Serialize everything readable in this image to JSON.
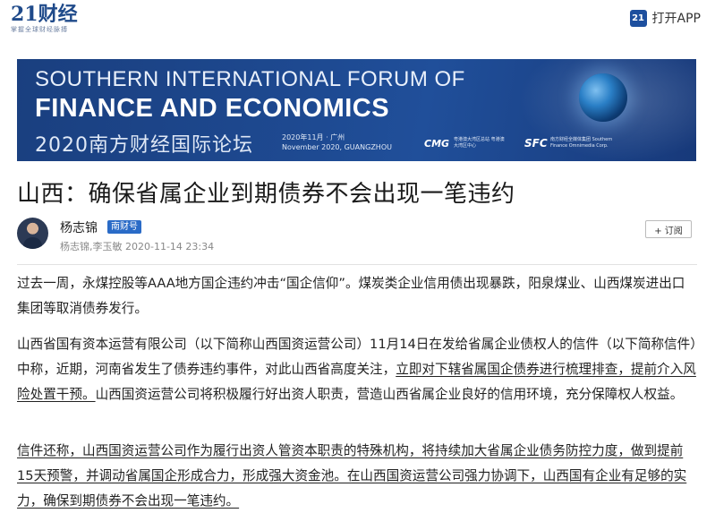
{
  "header": {
    "logo_text": "21财经",
    "logo_tagline": "掌握全球财经脉搏",
    "app_icon_text": "21",
    "app_button_label": "打开APP"
  },
  "banner": {
    "line1": "SOUTHERN INTERNATIONAL FORUM OF",
    "line2": "FINANCE AND ECONOMICS",
    "cn_title": "2020南方财经国际论坛",
    "date_cn": "2020年11月 · 广州",
    "date_en": "November 2020, GUANGZHOU",
    "logo_cmg": "CMG",
    "logo_cmg_sub": "粤港澳大湾区总站 粤港澳大湾区中心",
    "logo_sfc": "SFC",
    "logo_sfc_sub": "南方财经全媒体集团 Southern Finance Omnimedia Corp."
  },
  "article": {
    "title": "山西：确保省属企业到期债券不会出现一笔违约",
    "author": {
      "name": "杨志锦",
      "badge": "南财号",
      "meta": "杨志锦,李玉敏 2020-11-14 23:34",
      "subscribe_label": "+ 订阅"
    },
    "paragraphs": {
      "p1": "过去一周，永煤控股等AAA地方国企违约冲击“国企信仰”。煤炭类企业信用债出现暴跌，阳泉煤业、山西煤炭进出口集团等取消债券发行。",
      "p2_a": "山西省国有资本运营有限公司（以下简称山西国资运营公司）11月14日在发给省属企业债权人的信件（以下简称信件）中称，近期，河南省发生了债券违约事件，对此山西省高度关注，",
      "p2_u": "立即对下辖省属国企债券进行梳理排查，提前介入风险处置干预。",
      "p2_b": "山西国资运营公司将积极履行好出资人职责，营造山西省属企业良好的信用环境，充分保障权人权益。",
      "p3": "信件还称，山西国资运营公司作为履行出资人管资本职责的特殊机构，将持续加大省属企业债务防控力度，做到提前15天预警，并调动省属国企形成合力，形成强大资金池。在山西国资运营公司强力协调下，山西国有企业有足够的实力，确保到期债券不会出现一笔违约。"
    }
  },
  "colors": {
    "brand_blue": "#1f4a8a",
    "badge_blue": "#2a6bc7",
    "banner_blue": "#1e4a92"
  }
}
